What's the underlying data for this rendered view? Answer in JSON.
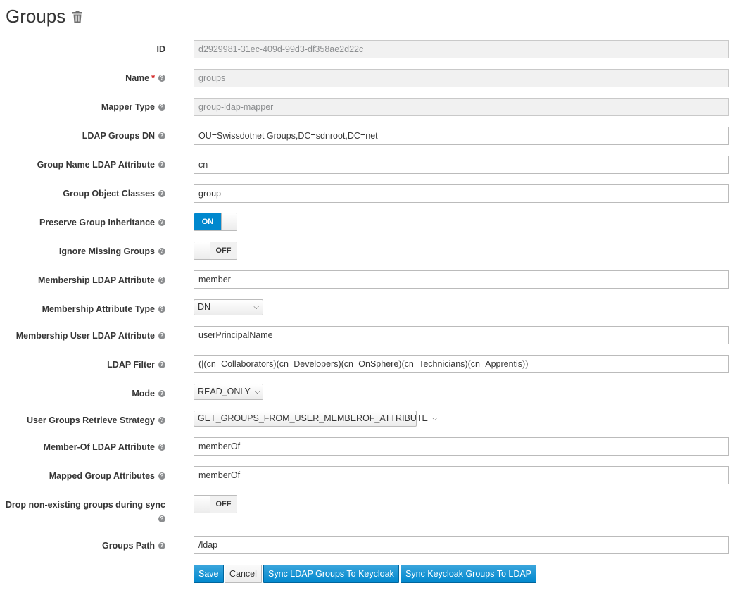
{
  "header": {
    "title": "Groups",
    "delete_icon": "trash-icon"
  },
  "fields": {
    "id": {
      "label": "ID",
      "value": "d2929981-31ec-409d-99d3-df358ae2d22c"
    },
    "name": {
      "label": "Name",
      "required_mark": "*",
      "value": "groups"
    },
    "mapper_type": {
      "label": "Mapper Type",
      "value": "group-ldap-mapper"
    },
    "ldap_groups_dn": {
      "label": "LDAP Groups DN",
      "value": "OU=Swissdotnet Groups,DC=sdnroot,DC=net"
    },
    "group_name_attr": {
      "label": "Group Name LDAP Attribute",
      "value": "cn"
    },
    "group_object_classes": {
      "label": "Group Object Classes",
      "value": "group"
    },
    "preserve_inheritance": {
      "label": "Preserve Group Inheritance",
      "state": "ON"
    },
    "ignore_missing": {
      "label": "Ignore Missing Groups",
      "state": "OFF"
    },
    "membership_attr": {
      "label": "Membership LDAP Attribute",
      "value": "member"
    },
    "membership_attr_type": {
      "label": "Membership Attribute Type",
      "selected": "DN"
    },
    "membership_user_attr": {
      "label": "Membership User LDAP Attribute",
      "value": "userPrincipalName"
    },
    "ldap_filter": {
      "label": "LDAP Filter",
      "value": "(|(cn=Collaborators)(cn=Developers)(cn=OnSphere)(cn=Technicians)(cn=Apprentis))"
    },
    "mode": {
      "label": "Mode",
      "selected": "READ_ONLY"
    },
    "retrieve_strategy": {
      "label": "User Groups Retrieve Strategy",
      "selected": "GET_GROUPS_FROM_USER_MEMBEROF_ATTRIBUTE"
    },
    "member_of_attr": {
      "label": "Member-Of LDAP Attribute",
      "value": "memberOf"
    },
    "mapped_group_attrs": {
      "label": "Mapped Group Attributes",
      "value": "memberOf"
    },
    "drop_non_existing": {
      "label_line1": "Drop non-existing groups during sync",
      "state": "OFF"
    },
    "groups_path": {
      "label": "Groups Path",
      "value": "/ldap"
    }
  },
  "help_glyph": "?",
  "toggle_text": {
    "on": "ON",
    "off": "OFF"
  },
  "buttons": {
    "save": "Save",
    "cancel": "Cancel",
    "sync_ldap_to_kc": "Sync LDAP Groups To Keycloak",
    "sync_kc_to_ldap": "Sync Keycloak Groups To LDAP"
  },
  "colors": {
    "primary": "#0088ce",
    "required": "#cc0000",
    "readonly_bg": "#f1f1f1"
  }
}
